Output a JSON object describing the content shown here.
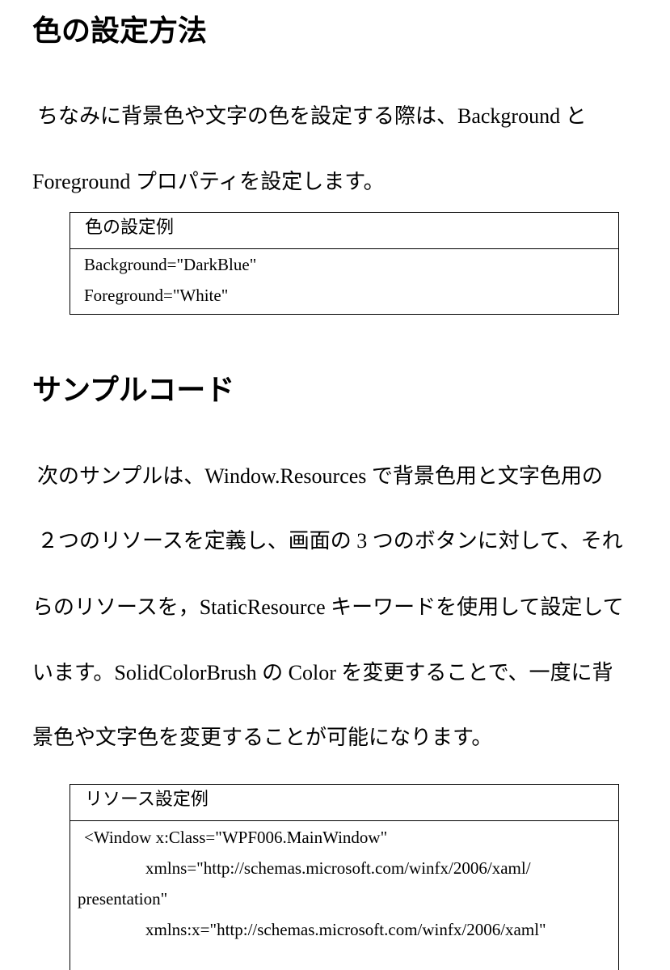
{
  "section_color": {
    "heading": "色の設定方法",
    "para_lines": [
      "ちなみに背景色や文字の色を設定する際は、Background と",
      "Foreground プロパティを設定します。"
    ],
    "example_box": {
      "title": "色の設定例",
      "lines": [
        "Background=\"DarkBlue\"",
        "Foreground=\"White\""
      ]
    }
  },
  "section_sample": {
    "heading": "サンプルコード",
    "para_lines": [
      "次のサンプルは、Window.Resources で背景色用と文字色用の",
      "２つのリソースを定義し、画面の 3 つのボタンに対して、それ",
      "らのリソースを，StaticResource キーワードを使用して設定して",
      "います。SolidColorBrush の Color を変更することで、一度に背",
      "景色や文字色を変更することが可能になります。"
    ],
    "example_box": {
      "title": "リソース設定例",
      "lines": [
        "<Window    x:Class=\"WPF006.MainWindow\"",
        "xmlns=\"http://schemas.microsoft.com/winfx/2006/xaml/",
        "presentation\"",
        "xmlns:x=\"http://schemas.microsoft.com/winfx/2006/xaml\""
      ]
    }
  }
}
